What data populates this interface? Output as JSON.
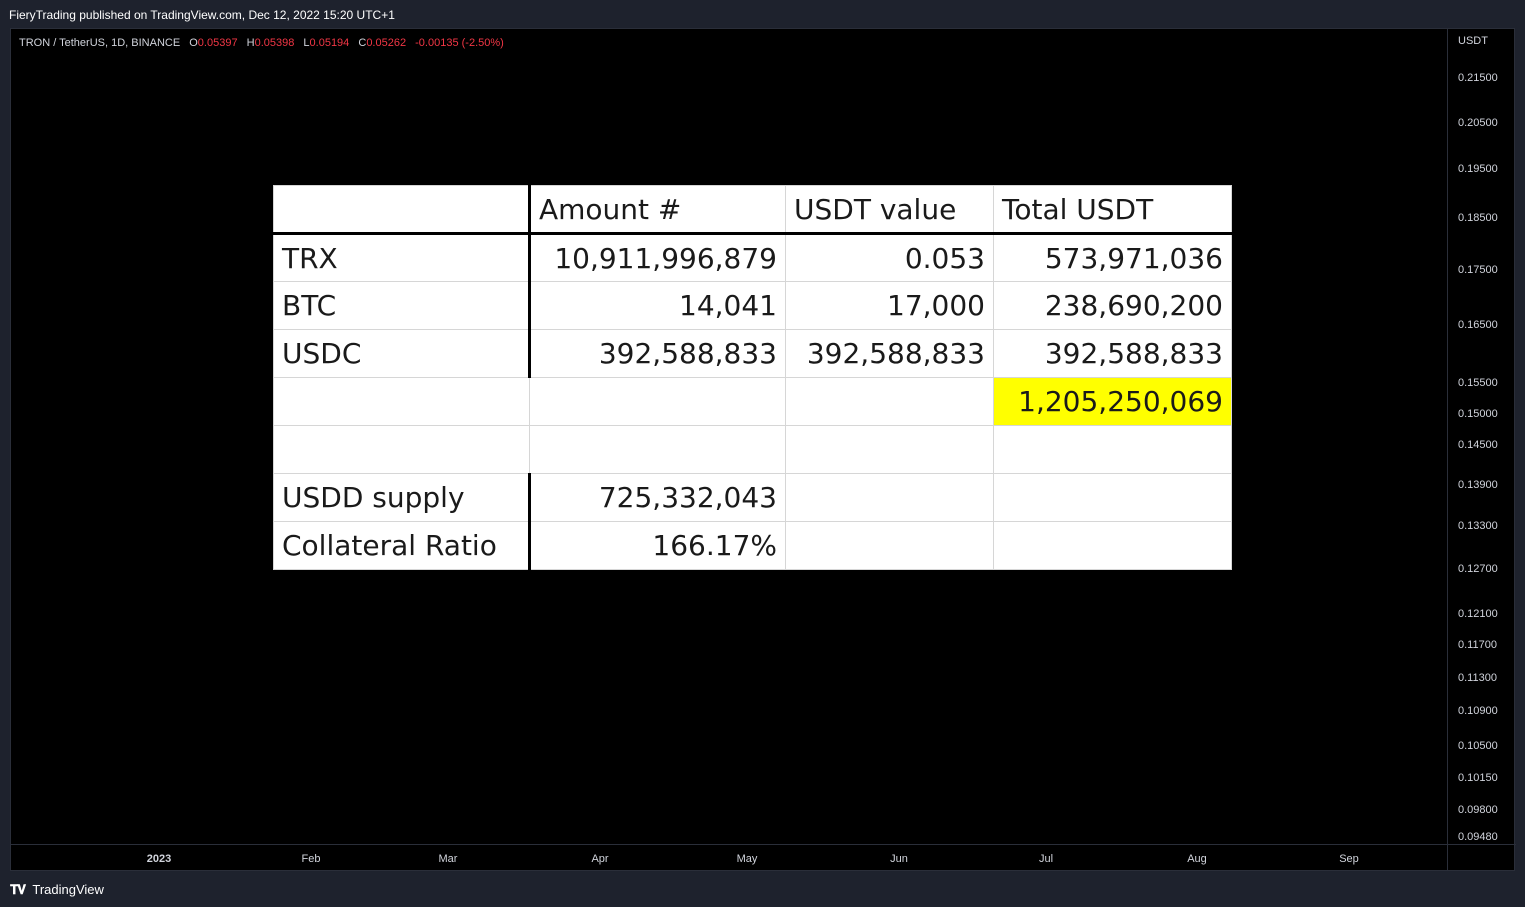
{
  "header": {
    "published": "FieryTrading published on TradingView.com, Dec 12, 2022 15:20 UTC+1"
  },
  "legend": {
    "symbol": "TRON / TetherUS, 1D, BINANCE",
    "o_label": "O",
    "o": "0.05397",
    "h_label": "H",
    "h": "0.05398",
    "l_label": "L",
    "l": "0.05194",
    "c_label": "C",
    "c": "0.05262",
    "change": "-0.00135 (-2.50%)"
  },
  "price_axis": {
    "currency": "USDT",
    "ticks": [
      "0.21500",
      "0.20500",
      "0.19500",
      "0.18500",
      "0.17500",
      "0.16500",
      "0.15500",
      "0.15000",
      "0.14500",
      "0.13900",
      "0.13300",
      "0.12700",
      "0.12100",
      "0.11700",
      "0.11300",
      "0.10900",
      "0.10500",
      "0.10150",
      "0.09800",
      "0.09480"
    ]
  },
  "time_axis": {
    "labels": [
      "2023",
      "Feb",
      "Mar",
      "Apr",
      "May",
      "Jun",
      "Jul",
      "Aug",
      "Sep"
    ]
  },
  "table": {
    "headers": [
      "",
      "Amount #",
      "USDT value",
      "Total USDT"
    ],
    "rows": [
      [
        "TRX",
        "10,911,996,879",
        "0.053",
        "573,971,036"
      ],
      [
        "BTC",
        "14,041",
        "17,000",
        "238,690,200"
      ],
      [
        "USDC",
        "392,588,833",
        "392,588,833",
        "392,588,833"
      ],
      [
        "",
        "",
        "",
        "1,205,250,069"
      ],
      [
        "",
        "",
        "",
        ""
      ],
      [
        "USDD supply",
        "725,332,043",
        "",
        ""
      ],
      [
        "Collateral Ratio",
        "166.17%",
        "",
        ""
      ]
    ],
    "highlight_color": "#ffff00"
  },
  "footer": {
    "brand": "TradingView",
    "logo_icon": "tradingview-logo-icon"
  }
}
